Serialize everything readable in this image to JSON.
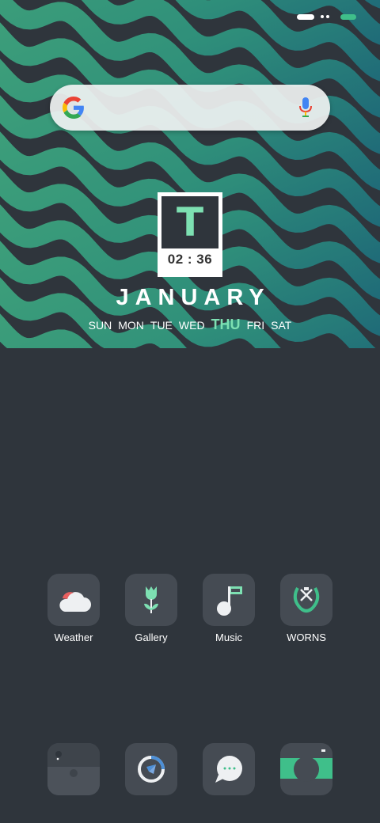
{
  "status_bar": {
    "icons": [
      "signal-icon",
      "more-dots-icon",
      "battery-icon"
    ]
  },
  "search_bar": {
    "placeholder": "",
    "value": ""
  },
  "calendar_widget": {
    "letter": "T",
    "time": "02 : 36",
    "month": "JANUARY",
    "days": [
      {
        "label": "SUN",
        "active": false
      },
      {
        "label": "MON",
        "active": false
      },
      {
        "label": "TUE",
        "active": false
      },
      {
        "label": "WED",
        "active": false
      },
      {
        "label": "THU",
        "active": true
      },
      {
        "label": "FRI",
        "active": false
      },
      {
        "label": "SAT",
        "active": false
      }
    ]
  },
  "apps": [
    {
      "label": "Weather"
    },
    {
      "label": "Gallery"
    },
    {
      "label": "Music"
    },
    {
      "label": "WORNS"
    }
  ],
  "dock": {
    "icons": [
      "wallet-icon",
      "browser-icon",
      "messages-icon",
      "camera-icon"
    ]
  },
  "colors": {
    "background": "#2f353c",
    "accent": "#7de0b2",
    "tile": "#454b53"
  }
}
